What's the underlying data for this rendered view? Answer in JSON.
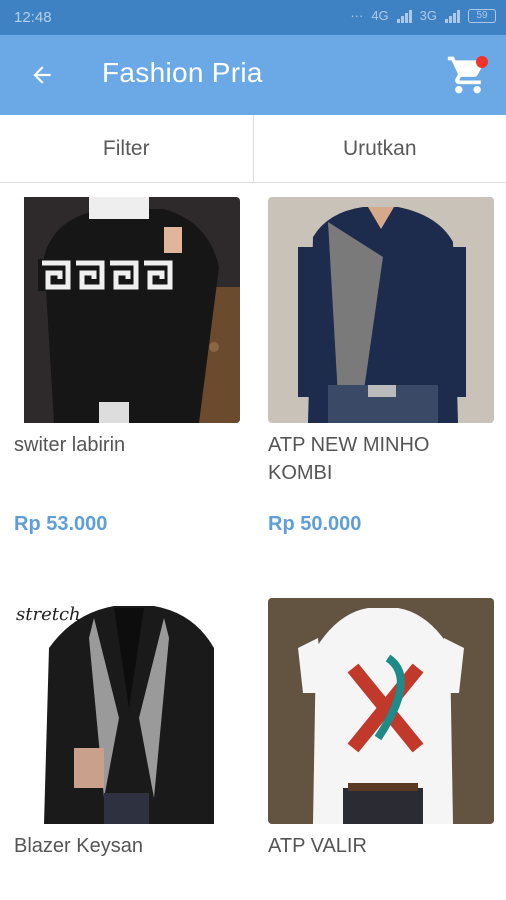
{
  "status_bar": {
    "time": "12:48",
    "network_labels": [
      "4G",
      "3G"
    ],
    "battery": "59"
  },
  "app_bar": {
    "title": "Fashion Pria",
    "back_icon": "arrow-left-icon",
    "cart_icon": "shopping-cart-icon",
    "cart_badge_color": "#f1332b",
    "background": "#6aa9e6"
  },
  "toolbar": {
    "filter_label": "Filter",
    "sort_label": "Urutkan"
  },
  "products": [
    {
      "name": "switer labirin",
      "price": "Rp 53.000"
    },
    {
      "name": "ATP NEW MINHO KOMBI",
      "price": "Rp 50.000"
    },
    {
      "name": "Blazer Keysan",
      "price": ""
    },
    {
      "name": "ATP VALIR",
      "price": ""
    }
  ],
  "price_color": "#5f9fd9"
}
